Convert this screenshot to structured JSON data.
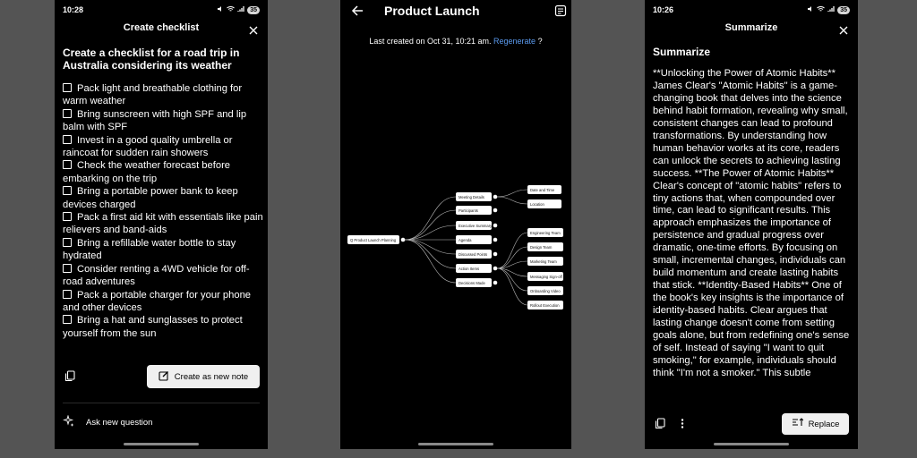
{
  "panel1": {
    "status": {
      "time": "10:28",
      "battery": "35"
    },
    "title": "Create checklist",
    "heading": "Create a checklist for a road trip in Australia considering its weather",
    "items": [
      "Pack light and breathable clothing for warm weather",
      "Bring sunscreen with high SPF and lip balm with SPF",
      "Invest in a good quality umbrella or raincoat for sudden rain showers",
      "Check the weather forecast before embarking on the trip",
      "Bring a portable power bank to keep devices charged",
      "Pack a first aid kit with essentials like pain relievers and band-aids",
      "Bring a refillable water bottle to stay hydrated",
      "Consider renting a 4WD vehicle for off-road adventures",
      "Pack a portable charger for your phone and other devices",
      "Bring a hat and sunglasses to protect yourself from the sun"
    ],
    "create_button": "Create as new note",
    "ask_label": "Ask new question"
  },
  "panel2": {
    "title": "Product Launch",
    "last_created": "Last created on Oct 31, 10:21 am.",
    "regenerate": "Regenerate",
    "question_mark": "?",
    "mindmap": {
      "root": "Q Product Launch Planning",
      "branches": [
        {
          "label": "Meeting Details",
          "children": [
            "Date and Time",
            "Location"
          ]
        },
        {
          "label": "Participants",
          "children": []
        },
        {
          "label": "Executive Summary",
          "children": []
        },
        {
          "label": "Agenda",
          "children": []
        },
        {
          "label": "Discussed Points",
          "children": []
        },
        {
          "label": "Action Items",
          "children": [
            "Engineering Team",
            "Design Team",
            "Marketing Team",
            "Messaging Sign-off",
            "Onboarding Video",
            "Rollout Execution"
          ]
        },
        {
          "label": "Decisions Made",
          "children": []
        }
      ]
    }
  },
  "panel3": {
    "status": {
      "time": "10:26",
      "battery": "35"
    },
    "title": "Summarize",
    "heading": "Summarize",
    "summary": "**Unlocking the Power of Atomic Habits** James Clear's \"Atomic Habits\" is a game-changing book that delves into the science behind habit formation, revealing why small, consistent changes can lead to profound transformations. By understanding how human behavior works at its core, readers can unlock the secrets to achieving lasting success. **The Power of Atomic Habits** Clear's concept of \"atomic habits\" refers to tiny actions that, when compounded over time, can lead to significant results. This approach emphasizes the importance of persistence and gradual progress over dramatic, one-time efforts. By focusing on small, incremental changes, individuals can build momentum and create lasting habits that stick. **Identity-Based Habits** One of the book's key insights is the importance of identity-based habits. Clear argues that lasting change doesn't come from setting goals alone, but from redefining one's sense of self. Instead of saying \"I want to quit smoking,\" for example, individuals should think \"I'm not a smoker.\" This subtle",
    "replace_button": "Replace"
  }
}
